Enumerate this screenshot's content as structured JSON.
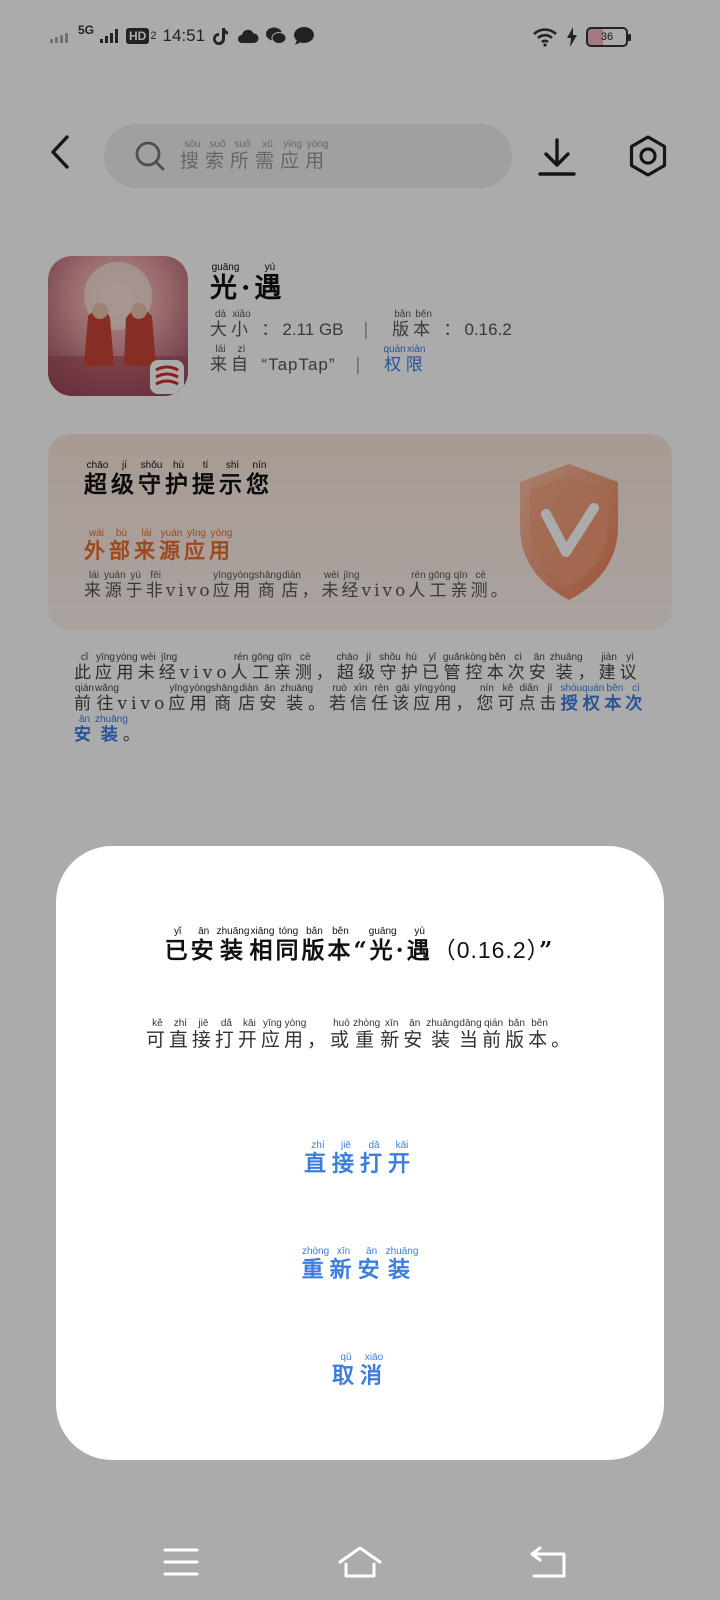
{
  "status_bar": {
    "network": "5G",
    "hd_badge": "HD",
    "hd_sub": "2",
    "time": "14:51",
    "battery": "36"
  },
  "search": {
    "placeholder": "搜索所需应用",
    "placeholder_pinyin": [
      "sōu",
      "suǒ",
      "suǒ",
      "xū",
      "yīng",
      "yòng"
    ]
  },
  "app": {
    "name_chars": [
      [
        "光",
        "guāng"
      ],
      [
        "·",
        ""
      ],
      [
        "遇",
        "yù"
      ]
    ],
    "size_label": [
      [
        "大",
        "dà"
      ],
      [
        "小",
        "xiǎo"
      ]
    ],
    "size_value": "2.11 GB",
    "version_label": [
      [
        "版",
        "bǎn"
      ],
      [
        "本",
        "běn"
      ]
    ],
    "version_value": "0.16.2",
    "source_prefix": [
      [
        "来",
        "lái"
      ],
      [
        "自",
        "zì"
      ]
    ],
    "source_value": "“TapTap”",
    "permission_link": [
      [
        "权",
        "quán"
      ],
      [
        "限",
        "xiàn"
      ]
    ]
  },
  "guard": {
    "title": [
      [
        "超",
        "chāo"
      ],
      [
        "级",
        "jí"
      ],
      [
        "守",
        "shǒu"
      ],
      [
        "护",
        "hù"
      ],
      [
        "提",
        "tí"
      ],
      [
        "示",
        "shì"
      ],
      [
        "您",
        "nín"
      ]
    ],
    "subtitle": [
      [
        "外",
        "wài"
      ],
      [
        "部",
        "bù"
      ],
      [
        "来",
        "lái"
      ],
      [
        "源",
        "yuán"
      ],
      [
        "应",
        "yīng"
      ],
      [
        "用",
        "yòng"
      ]
    ],
    "desc": [
      [
        "来",
        "lái"
      ],
      [
        "源",
        "yuán"
      ],
      [
        "于",
        "yú"
      ],
      [
        "非",
        "fēi"
      ],
      [
        "vivo",
        ""
      ],
      [
        "应",
        "yīng"
      ],
      [
        "用",
        "yòng"
      ],
      [
        "商",
        "shāng"
      ],
      [
        "店",
        "diàn"
      ],
      [
        "，",
        ""
      ],
      [
        "未",
        "wèi"
      ],
      [
        "经",
        "jīng"
      ],
      [
        "vivo",
        ""
      ],
      [
        "人",
        "rén"
      ],
      [
        "工",
        "gōng"
      ],
      [
        "亲",
        "qīn"
      ],
      [
        "测",
        "cè"
      ],
      [
        "。",
        ""
      ]
    ]
  },
  "notice": {
    "text": [
      [
        "此",
        "cǐ"
      ],
      [
        "应",
        "yīng"
      ],
      [
        "用",
        "yòng"
      ],
      [
        "未",
        "wèi"
      ],
      [
        "经",
        "jīng"
      ],
      [
        "vivo",
        ""
      ],
      [
        "人",
        "rén"
      ],
      [
        "工",
        "gōng"
      ],
      [
        "亲",
        "qīn"
      ],
      [
        "测",
        "cè"
      ],
      [
        "，",
        ""
      ],
      [
        "超",
        "chāo"
      ],
      [
        "级",
        "jí"
      ],
      [
        "守",
        "shǒu"
      ],
      [
        "护",
        "hù"
      ],
      [
        "已",
        "yǐ"
      ],
      [
        "管",
        "guǎn"
      ],
      [
        "控",
        "kòng"
      ],
      [
        "本",
        "běn"
      ],
      [
        "次",
        "cì"
      ],
      [
        "安",
        "ān"
      ],
      [
        "装",
        "zhuāng"
      ],
      [
        "，",
        ""
      ],
      [
        "建",
        "jiàn"
      ],
      [
        "议",
        "yì"
      ],
      [
        "前",
        "qián"
      ],
      [
        "往",
        "wǎng"
      ],
      [
        "vivo",
        ""
      ],
      [
        "应",
        "yīng"
      ],
      [
        "用",
        "yòng"
      ],
      [
        "商",
        "shāng"
      ],
      [
        "店",
        "diàn"
      ],
      [
        "安",
        "ān"
      ],
      [
        "装",
        "zhuāng"
      ],
      [
        "。",
        ""
      ],
      [
        "若",
        "ruò"
      ],
      [
        "信",
        "xìn"
      ],
      [
        "任",
        "rèn"
      ],
      [
        "该",
        "gāi"
      ],
      [
        "应",
        "yīng"
      ],
      [
        "用",
        "yòng"
      ],
      [
        "，",
        ""
      ],
      [
        "您",
        "nín"
      ],
      [
        "可",
        "kě"
      ],
      [
        "点",
        "diǎn"
      ],
      [
        "击",
        "jī"
      ]
    ],
    "link": [
      [
        "授",
        "shòu"
      ],
      [
        "权",
        "quán"
      ],
      [
        "本",
        "běn"
      ],
      [
        "次",
        "cì"
      ],
      [
        "安",
        "ān"
      ],
      [
        "装",
        "zhuāng"
      ]
    ],
    "end": "。"
  },
  "dialog": {
    "title_prefix": [
      [
        "已",
        "yǐ"
      ],
      [
        "安",
        "ān"
      ],
      [
        "装",
        "zhuāng"
      ],
      [
        "相",
        "xiāng"
      ],
      [
        "同",
        "tóng"
      ],
      [
        "版",
        "bǎn"
      ],
      [
        "本",
        "běn"
      ]
    ],
    "title_open_quote": "“",
    "title_app": [
      [
        "光",
        "guāng"
      ],
      [
        "·",
        ""
      ],
      [
        "遇",
        "yù"
      ]
    ],
    "title_version": "（0.16.2）",
    "title_close_quote": "”",
    "desc": [
      [
        "可",
        "kě"
      ],
      [
        "直",
        "zhí"
      ],
      [
        "接",
        "jiē"
      ],
      [
        "打",
        "dǎ"
      ],
      [
        "开",
        "kāi"
      ],
      [
        "应",
        "yīng"
      ],
      [
        "用",
        "yòng"
      ],
      [
        "，",
        ""
      ],
      [
        "或",
        "huò"
      ],
      [
        "重",
        "zhòng"
      ],
      [
        "新",
        "xīn"
      ],
      [
        "安",
        "ān"
      ],
      [
        "装",
        "zhuāng"
      ],
      [
        "当",
        "dāng"
      ],
      [
        "前",
        "qián"
      ],
      [
        "版",
        "bǎn"
      ],
      [
        "本",
        "běn"
      ],
      [
        "。",
        ""
      ]
    ],
    "open_button": [
      [
        "直",
        "zhí"
      ],
      [
        "接",
        "jiē"
      ],
      [
        "打",
        "dǎ"
      ],
      [
        "开",
        "kāi"
      ]
    ],
    "reinstall_button": [
      [
        "重",
        "zhòng"
      ],
      [
        "新",
        "xīn"
      ],
      [
        "安",
        "ān"
      ],
      [
        "装",
        "zhuāng"
      ]
    ],
    "cancel_button": [
      [
        "取",
        "qǔ"
      ],
      [
        "消",
        "xiāo"
      ]
    ]
  },
  "colors": {
    "accent": "#3d7de0",
    "warning": "#ec6d2b",
    "overlay": "rgba(0,0,0,0.33)"
  }
}
